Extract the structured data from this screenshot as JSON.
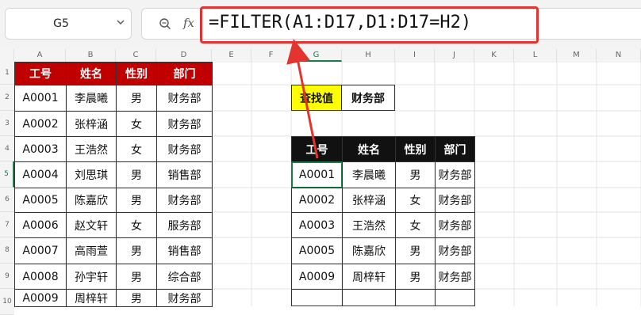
{
  "namebox": {
    "value": "G5"
  },
  "formula": {
    "fx_label": "fx",
    "text": "=FILTER(A1:D17,D1:D17=H2)"
  },
  "columns": [
    "A",
    "B",
    "C",
    "D",
    "E",
    "F",
    "G",
    "H",
    "I",
    "J",
    "K",
    "L",
    "M",
    "N"
  ],
  "rows": [
    "1",
    "2",
    "3",
    "4",
    "5",
    "6",
    "7",
    "8",
    "9",
    "10"
  ],
  "source_table": {
    "headers": [
      "工号",
      "姓名",
      "性别",
      "部门"
    ],
    "rows": [
      [
        "A0001",
        "李晨曦",
        "男",
        "财务部"
      ],
      [
        "A0002",
        "张梓涵",
        "女",
        "财务部"
      ],
      [
        "A0003",
        "王浩然",
        "女",
        "财务部"
      ],
      [
        "A0004",
        "刘思琪",
        "男",
        "销售部"
      ],
      [
        "A0005",
        "陈嘉欣",
        "男",
        "财务部"
      ],
      [
        "A0006",
        "赵文轩",
        "女",
        "服务部"
      ],
      [
        "A0007",
        "高雨萱",
        "男",
        "销售部"
      ],
      [
        "A0008",
        "孙宇轩",
        "男",
        "综合部"
      ],
      [
        "A0009",
        "周梓轩",
        "男",
        "财务部"
      ]
    ]
  },
  "lookup": {
    "label": "查找值",
    "value": "财务部"
  },
  "result_table": {
    "headers": [
      "工号",
      "姓名",
      "性别",
      "部门"
    ],
    "rows": [
      [
        "A0001",
        "李晨曦",
        "男",
        "财务部"
      ],
      [
        "A0002",
        "张梓涵",
        "女",
        "财务部"
      ],
      [
        "A0003",
        "王浩然",
        "女",
        "财务部"
      ],
      [
        "A0005",
        "陈嘉欣",
        "男",
        "财务部"
      ],
      [
        "A0009",
        "周梓轩",
        "男",
        "财务部"
      ]
    ]
  },
  "colors": {
    "red_header": "#c00000",
    "black_header": "#111111",
    "highlight": "#e3342f",
    "selection": "#1f7b46",
    "lookup_fill": "#ffff00"
  }
}
